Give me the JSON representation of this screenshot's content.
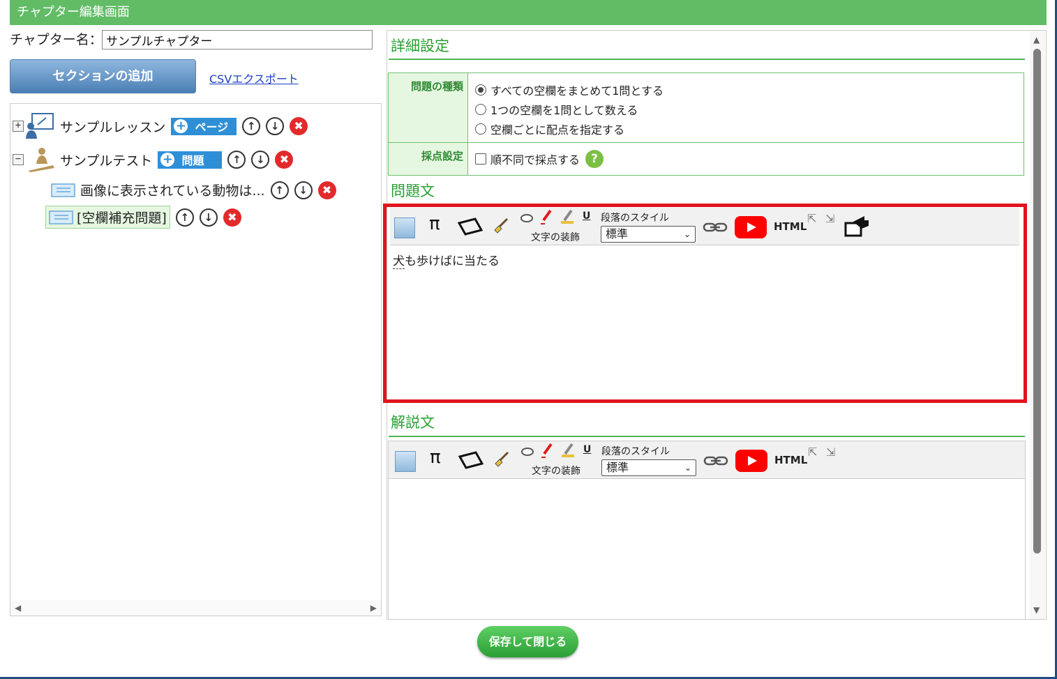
{
  "window": {
    "title": "チャプター編集画面"
  },
  "chapter": {
    "name_label": "チャプター名：",
    "name_value": "サンプルチャプター"
  },
  "actions": {
    "add_section": "セクションの追加",
    "csv_export": "CSVエクスポート",
    "save_close": "保存して閉じる"
  },
  "tree": {
    "lesson": {
      "expander": "+",
      "label": "サンプルレッスン",
      "badge": "ページ"
    },
    "test": {
      "expander": "−",
      "label": "サンプルテスト",
      "badge": "問題"
    },
    "items": [
      {
        "label": "画像に表示されている動物は..."
      },
      {
        "label": "[空欄補充問題]"
      }
    ]
  },
  "details": {
    "title": "詳細設定",
    "question_type": {
      "header": "問題の種類",
      "options": [
        "すべての空欄をまとめて1問とする",
        "1つの空欄を1問として数える",
        "空欄ごとに配点を指定する"
      ],
      "selected_index": 0
    },
    "scoring": {
      "header": "採点設定",
      "checkbox_label": "順不同で採点する",
      "checked": false,
      "help": "?"
    }
  },
  "question_text": {
    "title": "問題文",
    "blank_word": "犬",
    "content_rest": "も歩けばに当たる"
  },
  "explanation": {
    "title": "解説文",
    "content": ""
  },
  "toolbar": {
    "pi": "π",
    "underline": "U",
    "decoration_label": "文字の装飾",
    "paragraph_style_label": "段落のスタイル",
    "paragraph_style_value": "標準",
    "html_label": "HTML",
    "chevron": "⌄",
    "expand": "⇱",
    "collapse": "⇲"
  },
  "icons": {
    "up": "↑",
    "down": "↓",
    "delete": "✖",
    "plus": "+",
    "scroll_up": "▲",
    "scroll_down": "▼",
    "scroll_left": "◀",
    "scroll_right": "▶"
  },
  "colors": {
    "header_green": "#62bc66",
    "accent_blue": "#2f8fd6",
    "delete_red": "#e32a2a",
    "highlight_red": "#e1141e",
    "title_green": "#27a031"
  }
}
